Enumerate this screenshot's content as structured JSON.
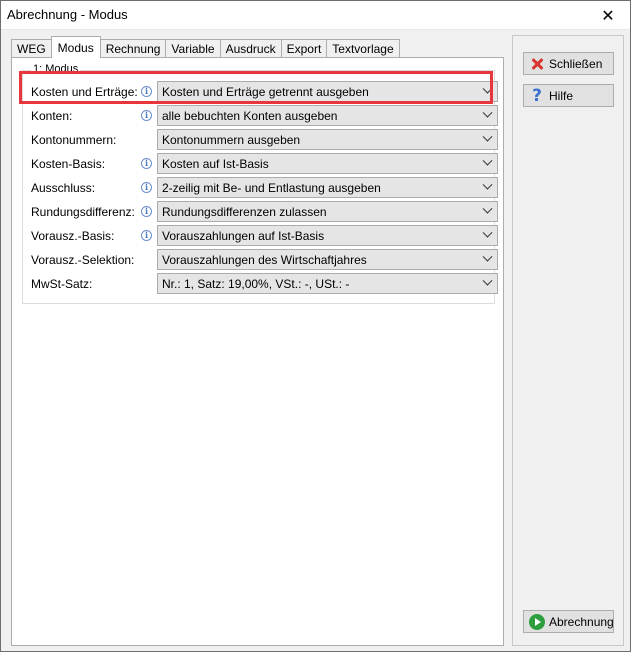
{
  "window": {
    "title": "Abrechnung - Modus",
    "close_glyph": "✕"
  },
  "tabs": [
    {
      "label": "WEG"
    },
    {
      "label": "Modus"
    },
    {
      "label": "Rechnung"
    },
    {
      "label": "Variable"
    },
    {
      "label": "Ausdruck"
    },
    {
      "label": "Export"
    },
    {
      "label": "Textvorlage"
    }
  ],
  "group": {
    "title": "1: Modus",
    "rows": [
      {
        "label": "Kosten und Erträge:",
        "value": "Kosten und Erträge getrennt ausgeben",
        "info": true
      },
      {
        "label": "Konten:",
        "value": "alle bebuchten Konten ausgeben",
        "info": true
      },
      {
        "label": "Kontonummern:",
        "value": "Kontonummern ausgeben",
        "info": false
      },
      {
        "label": "Kosten-Basis:",
        "value": "Kosten auf Ist-Basis",
        "info": true
      },
      {
        "label": "Ausschluss:",
        "value": "2-zeilig mit Be- und Entlastung ausgeben",
        "info": true
      },
      {
        "label": "Rundungsdifferenz:",
        "value": "Rundungsdifferenzen zulassen",
        "info": true
      },
      {
        "label": "Vorausz.-Basis:",
        "value": "Vorauszahlungen auf Ist-Basis",
        "info": true
      },
      {
        "label": "Vorausz.-Selektion:",
        "value": "Vorauszahlungen des Wirtschaftjahres",
        "info": false
      },
      {
        "label": "MwSt-Satz:",
        "value": "Nr.: 1,  Satz: 19,00%,  VSt.: -,  USt.: -",
        "info": false
      }
    ],
    "info_glyph": "i"
  },
  "buttons": {
    "close": "Schließen",
    "help": "Hilfe",
    "billing": "Abrechnung",
    "help_glyph": "?"
  },
  "colors": {
    "highlight": "#e8373c",
    "help_icon": "#3b6fd1",
    "next_icon": "#2e9e3e"
  },
  "icons": [
    "close-icon",
    "info-icon",
    "chevron-down-icon",
    "help-icon",
    "arrow-right-icon"
  ]
}
